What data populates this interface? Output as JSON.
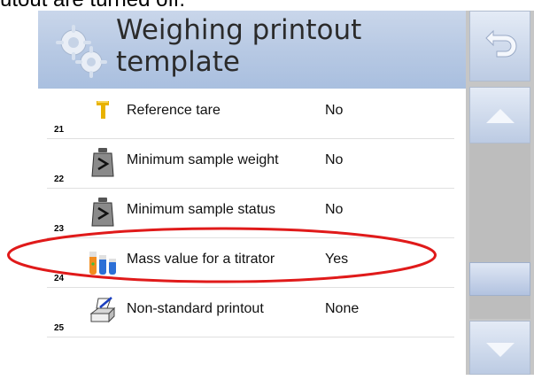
{
  "caption": {
    "text": "utout are turned off."
  },
  "header": {
    "title": "Weighing printout template"
  },
  "rows": [
    {
      "num": "21",
      "label": "Reference tare",
      "value": "No",
      "icon": "tare-icon"
    },
    {
      "num": "22",
      "label": "Minimum sample weight",
      "value": "No",
      "icon": "weight-icon"
    },
    {
      "num": "23",
      "label": "Minimum sample status",
      "value": "No",
      "icon": "weight-icon"
    },
    {
      "num": "24",
      "label": "Mass value for a titrator",
      "value": "Yes",
      "icon": "titrator-icon"
    },
    {
      "num": "25",
      "label": "Non-standard printout",
      "value": "None",
      "icon": "printer-icon"
    }
  ],
  "colors": {
    "header": "#b6c8e3",
    "highlight": "#e01a1a",
    "side_panel": "#c6c6c6"
  },
  "side": {
    "buttons": [
      "back-icon",
      "arrow-up-icon",
      "arrow-down-icon"
    ]
  }
}
